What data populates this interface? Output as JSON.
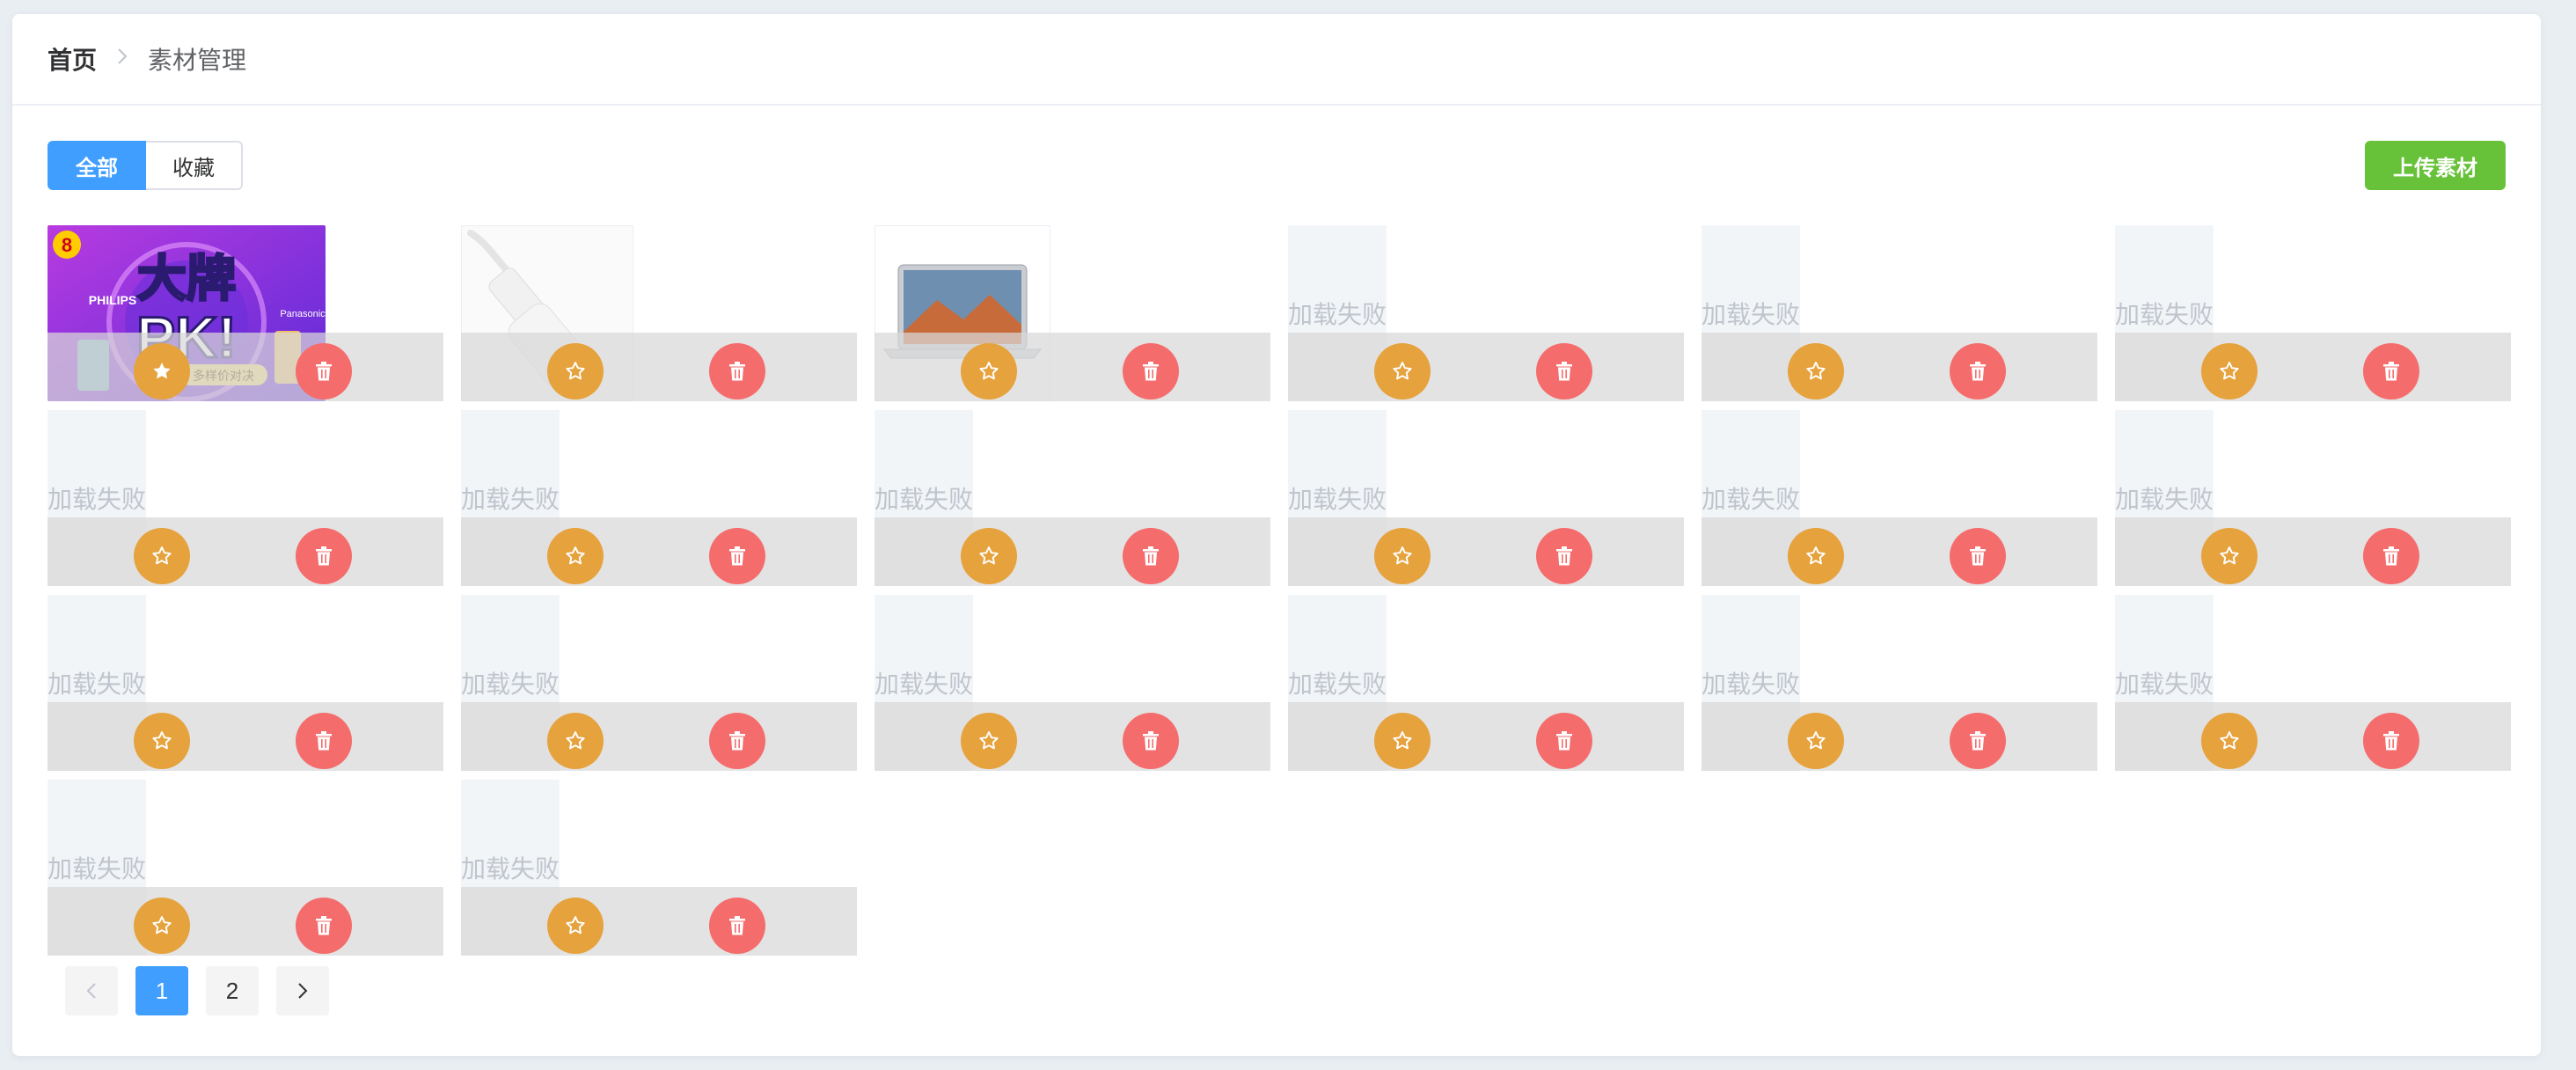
{
  "breadcrumb": {
    "home": "首页",
    "current": "素材管理"
  },
  "tabs": {
    "all": "全部",
    "favorites": "收藏"
  },
  "upload_label": "上传素材",
  "load_failed_text": "加载失败",
  "assets": [
    {
      "status": "loaded",
      "image": "promo-banner-大牌PK",
      "favorited": true
    },
    {
      "status": "loaded",
      "image": "white-adapter-cable",
      "favorited": false
    },
    {
      "status": "loaded",
      "image": "laptop",
      "favorited": false
    },
    {
      "status": "failed",
      "favorited": false
    },
    {
      "status": "failed",
      "favorited": false
    },
    {
      "status": "failed",
      "favorited": false
    },
    {
      "status": "failed",
      "favorited": false
    },
    {
      "status": "failed",
      "favorited": false
    },
    {
      "status": "failed",
      "favorited": false
    },
    {
      "status": "failed",
      "favorited": false
    },
    {
      "status": "failed",
      "favorited": false
    },
    {
      "status": "failed",
      "favorited": false
    },
    {
      "status": "failed",
      "favorited": false
    },
    {
      "status": "failed",
      "favorited": false
    },
    {
      "status": "failed",
      "favorited": false
    },
    {
      "status": "failed",
      "favorited": false
    },
    {
      "status": "failed",
      "favorited": false
    },
    {
      "status": "failed",
      "favorited": false
    },
    {
      "status": "failed",
      "favorited": false
    },
    {
      "status": "failed",
      "favorited": false
    }
  ],
  "promo": {
    "headline": "大牌",
    "pk": "PK!",
    "badge": "8",
    "brand_left": "PHILIPS",
    "brand_right": "Panasonic",
    "tag": "多样价对决"
  },
  "pagination": {
    "pages": [
      "1",
      "2"
    ],
    "current": "1"
  },
  "colors": {
    "primary": "#409eff",
    "success": "#67c23a",
    "warning": "#e6a23c",
    "danger": "#f56c6c"
  }
}
